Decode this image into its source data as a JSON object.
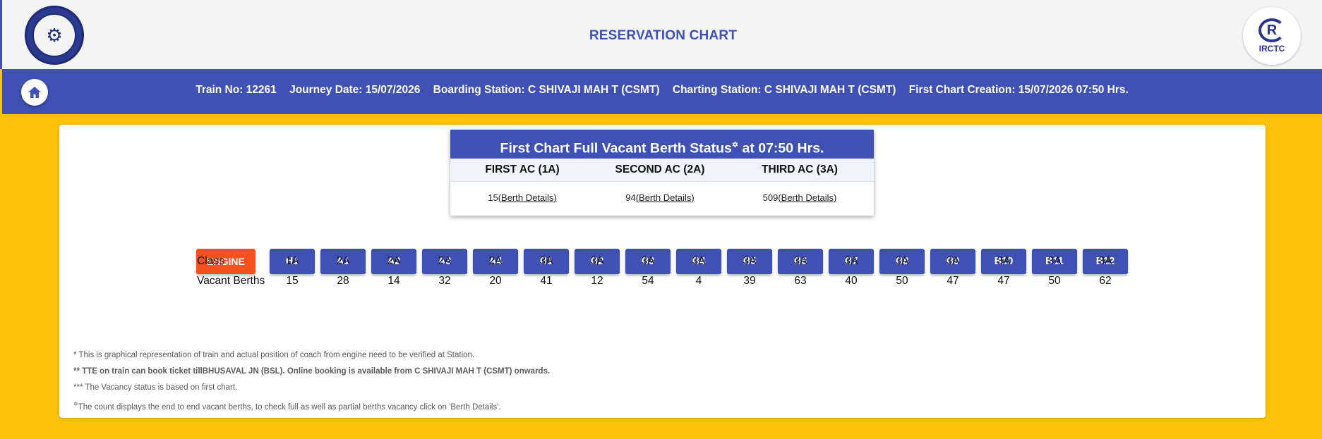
{
  "header": {
    "title": "RESERVATION CHART",
    "left_logo": "indian-railways-logo",
    "right_logo_text": "IRCTC"
  },
  "info_bar": {
    "train_no": "Train No: 12261",
    "journey_date": "Journey Date: 15/07/2026",
    "boarding_station": "Boarding Station: C SHIVAJI MAH T (CSMT)",
    "charting_station": "Charting Station: C SHIVAJI MAH T (CSMT)",
    "first_chart_creation": "First Chart Creation: 15/07/2026 07:50 Hrs."
  },
  "vacant_status": {
    "title_prefix": "First Chart Full Vacant Berth Status",
    "title_mark": "✡",
    "title_suffix": " at 07:50 Hrs.",
    "columns": [
      {
        "label": "FIRST AC (1A)",
        "count": "15",
        "link": "(Berth Details)"
      },
      {
        "label": "SECOND AC (2A)",
        "count": "94",
        "link": "(Berth Details)"
      },
      {
        "label": "THIRD AC (3A)",
        "count": "509",
        "link": "(Berth Details)"
      }
    ]
  },
  "coaches": {
    "engine_label": "ENGINE",
    "class_label": "Class",
    "vacant_label": "Vacant Berths",
    "items": [
      {
        "name": "H1",
        "class": "1A",
        "vacant": "15"
      },
      {
        "name": "A1",
        "class": "2A",
        "vacant": "28"
      },
      {
        "name": "A2",
        "class": "2A",
        "vacant": "14"
      },
      {
        "name": "A3",
        "class": "2A",
        "vacant": "32"
      },
      {
        "name": "A4",
        "class": "2A",
        "vacant": "20"
      },
      {
        "name": "B1",
        "class": "3A",
        "vacant": "41"
      },
      {
        "name": "B2",
        "class": "3A",
        "vacant": "12"
      },
      {
        "name": "B3",
        "class": "3A",
        "vacant": "54"
      },
      {
        "name": "B4",
        "class": "3A",
        "vacant": "4"
      },
      {
        "name": "B5",
        "class": "3A",
        "vacant": "39"
      },
      {
        "name": "B6",
        "class": "3A",
        "vacant": "63"
      },
      {
        "name": "B7",
        "class": "3A",
        "vacant": "40"
      },
      {
        "name": "B8",
        "class": "3A",
        "vacant": "50"
      },
      {
        "name": "B9",
        "class": "3A",
        "vacant": "47"
      },
      {
        "name": "B10",
        "class": "3A",
        "vacant": "47"
      },
      {
        "name": "B11",
        "class": "3A",
        "vacant": "50"
      },
      {
        "name": "B12",
        "class": "3A",
        "vacant": "62"
      }
    ]
  },
  "notes": {
    "note1": "* This is graphical representation of train and actual position of coach from engine need to be verified at Station.",
    "note2": "** TTE on train can book ticket tillBHUSAVAL JN (BSL). Online booking is available from C SHIVAJI MAH T (CSMT) onwards.",
    "note3": "*** The Vacancy status is based on first chart.",
    "note4_mark": "✡",
    "note4": "The count displays the end to end vacant berths, to check full as well as partial berths vacancy click on 'Berth Details'."
  },
  "colors": {
    "primary": "#3f51b5",
    "engine": "#f4511e",
    "background": "#ffc10a"
  }
}
